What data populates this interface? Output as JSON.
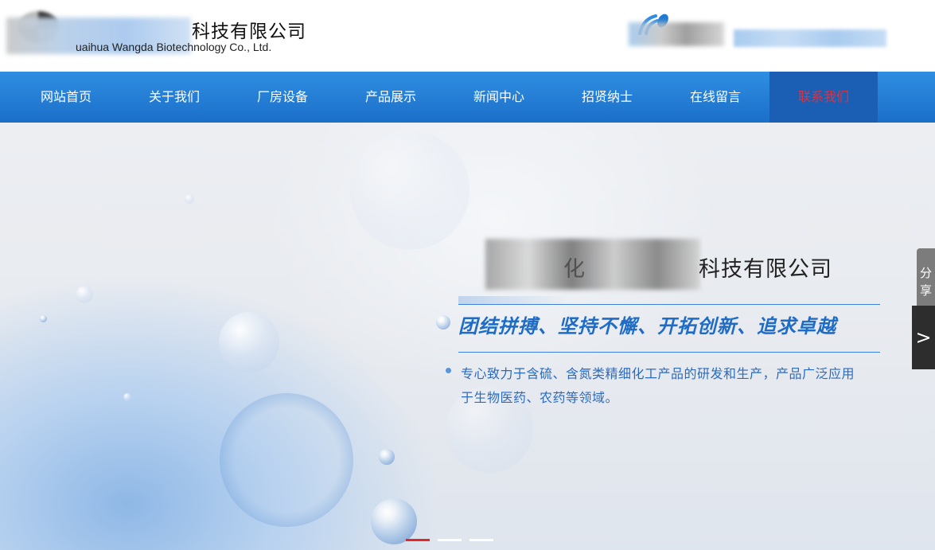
{
  "header": {
    "company_cn": "科技有限公司",
    "company_en": "uaihua Wangda Biotechnology Co., Ltd.",
    "logo_icon": "company-logo-icon",
    "phone_icon": "phone-icon"
  },
  "nav": {
    "items": [
      {
        "label": "网站首页"
      },
      {
        "label": "关于我们"
      },
      {
        "label": "厂房设备"
      },
      {
        "label": "产品展示"
      },
      {
        "label": "新闻中心"
      },
      {
        "label": "招贤纳士"
      },
      {
        "label": "在线留言"
      },
      {
        "label": "联系我们"
      }
    ],
    "active_index": 7
  },
  "banner": {
    "company_partial": "化",
    "company_suffix": "科技有限公司",
    "slogan": "团结拼搏、坚持不懈、开拓创新、追求卓越",
    "description": "专心致力于含硫、含氮类精细化工产品的研发和生产，产品广泛应用于生物医药、农药等领域。",
    "slide_count": 3,
    "active_slide": 0
  },
  "share": {
    "label_line1": "分",
    "label_line2": "享"
  },
  "next_arrow": ">",
  "colors": {
    "nav_bg": "#1f7ad3",
    "nav_active_bg": "#1a5fb4",
    "nav_active_text": "#e0323c",
    "slogan": "#1f6cc6",
    "pagination_active": "#e02a2a"
  }
}
